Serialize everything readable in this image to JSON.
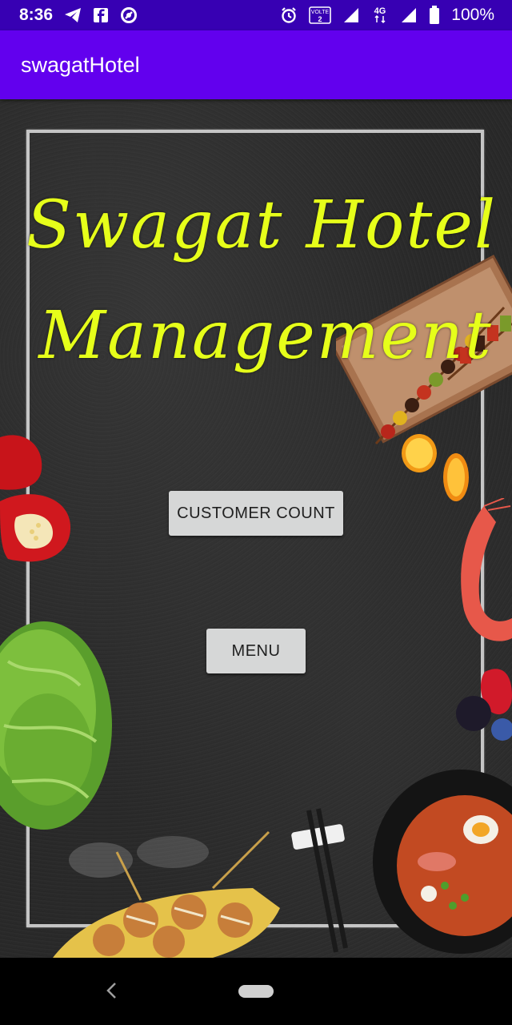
{
  "status_bar": {
    "time": "8:36",
    "left_icons": [
      "telegram-icon",
      "facebook-icon",
      "sync-icon"
    ],
    "right_icons": [
      "alarm-icon",
      "volte-icon",
      "signal-icon",
      "network-4g-icon",
      "signal-icon",
      "battery-icon"
    ],
    "volte_label": "VOLTE",
    "volte_sim": "2",
    "network_label": "4G",
    "battery": "100%"
  },
  "app_bar": {
    "title": "swagatHotel",
    "color": "#6200ee",
    "status_color": "#3700b3"
  },
  "main": {
    "title_line1": "Swagat Hotel",
    "title_line2": "Management",
    "title_color": "#e6ff1a",
    "customer_count_label": "CUSTOMER COUNT",
    "menu_label": "MENU"
  },
  "decorations": [
    "skewers-image",
    "orange-slice-image",
    "red-pepper-image",
    "shrimp-image",
    "lettuce-image",
    "berries-image",
    "chopsticks-image",
    "ramen-bowl-image",
    "takoyaki-image"
  ],
  "nav_bar": {
    "icons": [
      "back-icon",
      "home-pill-icon"
    ]
  }
}
